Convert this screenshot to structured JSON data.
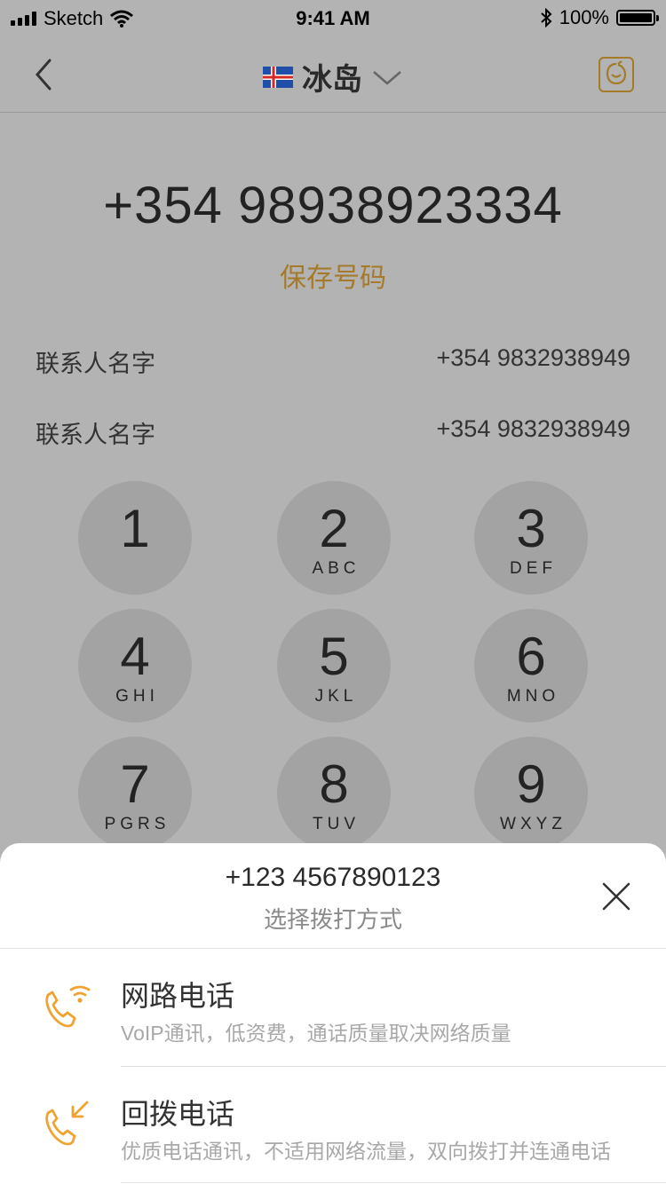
{
  "status_bar": {
    "carrier": "Sketch",
    "time": "9:41 AM",
    "battery": "100%"
  },
  "nav": {
    "country": "冰岛"
  },
  "dialer": {
    "number": "+354 98938923334",
    "save_label": "保存号码",
    "contacts": [
      {
        "name": "联系人名字",
        "number": "+354 9832938949"
      },
      {
        "name": "联系人名字",
        "number": "+354 9832938949"
      }
    ],
    "keys": [
      {
        "digit": "1",
        "letters": ""
      },
      {
        "digit": "2",
        "letters": "ABC"
      },
      {
        "digit": "3",
        "letters": "DEF"
      },
      {
        "digit": "4",
        "letters": "GHI"
      },
      {
        "digit": "5",
        "letters": "JKL"
      },
      {
        "digit": "6",
        "letters": "MNO"
      },
      {
        "digit": "7",
        "letters": "PGRS"
      },
      {
        "digit": "8",
        "letters": "TUV"
      },
      {
        "digit": "9",
        "letters": "WXYZ"
      }
    ]
  },
  "sheet": {
    "number": "+123 4567890123",
    "subtitle": "选择拨打方式",
    "options": [
      {
        "title": "网路电话",
        "desc": "VoIP通讯，低资费，通话质量取决网络质量",
        "icon": "voip-phone-icon"
      },
      {
        "title": "回拨电话",
        "desc": "优质电话通讯，不适用网络流量，双向拨打并连通电话",
        "icon": "callback-phone-icon"
      }
    ]
  },
  "colors": {
    "accent": "#f0a330",
    "save": "#a57a2a",
    "overlay": "#b3b3b3"
  }
}
